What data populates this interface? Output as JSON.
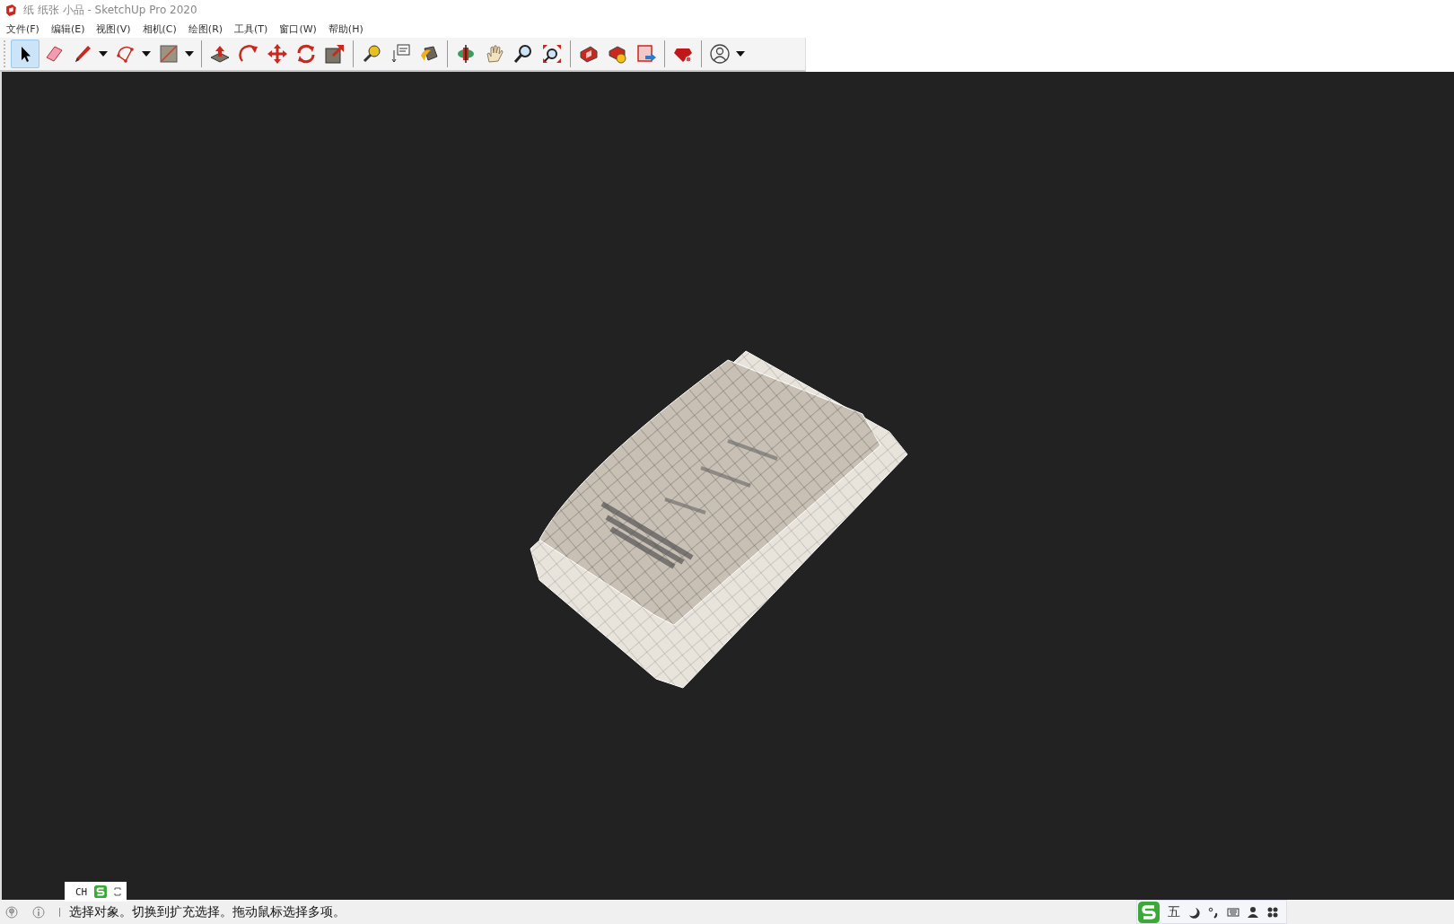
{
  "window": {
    "title": "纸 纸张 小品 - SketchUp Pro 2020"
  },
  "menu": [
    "文件(F)",
    "编辑(E)",
    "视图(V)",
    "相机(C)",
    "绘图(R)",
    "工具(T)",
    "窗口(W)",
    "帮助(H)"
  ],
  "toolbar": [
    [
      {
        "kind": "select",
        "selected": true,
        "dropdown": false
      },
      {
        "kind": "eraser",
        "selected": false,
        "dropdown": false
      },
      {
        "kind": "pencil",
        "selected": false,
        "dropdown": true
      },
      {
        "kind": "arc",
        "selected": false,
        "dropdown": true
      },
      {
        "kind": "rectangle",
        "selected": false,
        "dropdown": true
      }
    ],
    [
      {
        "kind": "pushpull",
        "selected": false,
        "dropdown": false
      },
      {
        "kind": "followme",
        "selected": false,
        "dropdown": false
      },
      {
        "kind": "move",
        "selected": false,
        "dropdown": false
      },
      {
        "kind": "rotate",
        "selected": false,
        "dropdown": false
      },
      {
        "kind": "scale",
        "selected": false,
        "dropdown": false
      }
    ],
    [
      {
        "kind": "tape",
        "selected": false,
        "dropdown": false
      },
      {
        "kind": "text",
        "selected": false,
        "dropdown": false
      },
      {
        "kind": "paint",
        "selected": false,
        "dropdown": false
      }
    ],
    [
      {
        "kind": "orbit",
        "selected": false,
        "dropdown": false
      },
      {
        "kind": "pan",
        "selected": false,
        "dropdown": false
      },
      {
        "kind": "zoom",
        "selected": false,
        "dropdown": false
      },
      {
        "kind": "zoomext",
        "selected": false,
        "dropdown": false
      }
    ],
    [
      {
        "kind": "warehouse",
        "selected": false,
        "dropdown": false
      },
      {
        "kind": "extension",
        "selected": false,
        "dropdown": false
      },
      {
        "kind": "layout",
        "selected": false,
        "dropdown": false
      }
    ],
    [
      {
        "kind": "ruby",
        "selected": false,
        "dropdown": false
      }
    ],
    [
      {
        "kind": "account",
        "selected": false,
        "dropdown": true
      }
    ]
  ],
  "ime_mini": {
    "label": "CH"
  },
  "status_bar": {
    "message": "选择对象。切换到扩充选择。拖动鼠标选择多项。"
  },
  "ime_bar": {
    "mode": "五"
  }
}
